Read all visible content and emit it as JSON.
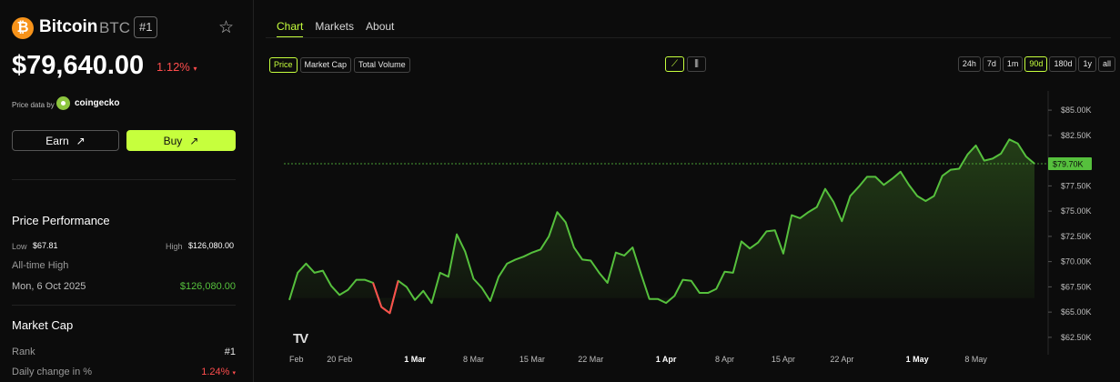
{
  "coin": {
    "logo_symbol": "₿",
    "name": "Bitcoin",
    "symbol": "BTC",
    "rank_badge": "#1",
    "price": "$79,640.00",
    "change_pct": "1.12%",
    "change_arrow": "▾",
    "price_source_label": "Price data by",
    "price_source_name": "coingecko"
  },
  "actions": {
    "earn_label": "Earn",
    "earn_icon": "↗",
    "buy_label": "Buy",
    "buy_icon": "↗"
  },
  "performance": {
    "title": "Price Performance",
    "low_label": "Low",
    "low_value": "$67.81",
    "high_label": "High",
    "high_value": "$126,080.00",
    "ath_label": "All-time High",
    "ath_date": "Mon, 6 Oct 2025",
    "ath_value": "$126,080.00"
  },
  "market_cap": {
    "title": "Market Cap",
    "rank_label": "Rank",
    "rank_value": "#1",
    "daily_change_label": "Daily change in %",
    "daily_change_value": "1.24%",
    "daily_change_arrow": "▾"
  },
  "tabs": [
    {
      "label": "Chart",
      "active": true
    },
    {
      "label": "Markets",
      "active": false
    },
    {
      "label": "About",
      "active": false
    }
  ],
  "metric_buttons": [
    {
      "label": "Price",
      "active": true
    },
    {
      "label": "Market Cap",
      "active": false
    },
    {
      "label": "Total Volume",
      "active": false
    }
  ],
  "view_buttons": [
    {
      "icon": "line-chart-icon",
      "glyph": "⟋",
      "active": true
    },
    {
      "icon": "candlestick-icon",
      "glyph": "⫼",
      "active": false
    }
  ],
  "range_buttons": [
    {
      "label": "24h",
      "active": false
    },
    {
      "label": "7d",
      "active": false
    },
    {
      "label": "1m",
      "active": false
    },
    {
      "label": "90d",
      "active": true
    },
    {
      "label": "180d",
      "active": false
    },
    {
      "label": "1y",
      "active": false
    },
    {
      "label": "all",
      "active": false
    }
  ],
  "watermark": "TV",
  "colors": {
    "accent": "#c6ff3d",
    "up": "#56c03d",
    "down": "#ff4d4d"
  },
  "chart_data": {
    "type": "line",
    "current_label": "$79.70K",
    "current_value": 79700,
    "ylim": [
      61500,
      86000
    ],
    "yticks": [
      62500,
      65000,
      67500,
      70000,
      72500,
      75000,
      77500,
      80000,
      82500,
      85000
    ],
    "ytick_labels": [
      "$62.50K",
      "$65.00K",
      "$67.50K",
      "$70.00K",
      "$72.50K",
      "$75.00K",
      "$77.50K",
      "$80.00K",
      "$82.50K",
      "$85.00K"
    ],
    "xticks": [
      {
        "label": "Feb",
        "index": 0,
        "bold": false
      },
      {
        "label": "20 Feb",
        "index": 6,
        "bold": false
      },
      {
        "label": "1 Mar",
        "index": 15,
        "bold": true
      },
      {
        "label": "8 Mar",
        "index": 22,
        "bold": false
      },
      {
        "label": "15 Mar",
        "index": 29,
        "bold": false
      },
      {
        "label": "22 Mar",
        "index": 36,
        "bold": false
      },
      {
        "label": "1 Apr",
        "index": 45,
        "bold": true
      },
      {
        "label": "8 Apr",
        "index": 52,
        "bold": false
      },
      {
        "label": "15 Apr",
        "index": 59,
        "bold": false
      },
      {
        "label": "22 Apr",
        "index": 66,
        "bold": false
      },
      {
        "label": "1 May",
        "index": 75,
        "bold": true
      },
      {
        "label": "8 May",
        "index": 82,
        "bold": false
      }
    ],
    "series": [
      {
        "values": [
          66200,
          68900,
          69800,
          68900,
          69100,
          67600,
          66700,
          67200,
          68200,
          68200,
          67900,
          65500,
          64900,
          68100,
          67500,
          66200,
          67100,
          65900,
          68900,
          68500,
          72700,
          71000,
          68300,
          67400,
          66100,
          68500,
          69800,
          70200,
          70500,
          70900,
          71200,
          72500,
          74900,
          73900,
          71400,
          70200,
          70100,
          68900,
          67900,
          70900,
          70600,
          71400,
          68800,
          66300,
          66300,
          65900,
          66600,
          68200,
          68100,
          66900,
          66900,
          67300,
          69000,
          68900,
          72000,
          71300,
          71900,
          73000,
          73100,
          70800,
          74600,
          74300,
          74900,
          75400,
          77200,
          75900,
          74000,
          76500,
          77400,
          78400,
          78400,
          77600,
          78200,
          78900,
          77600,
          76500,
          76000,
          76500,
          78500,
          79100,
          79200,
          80600,
          81500,
          80000,
          80200,
          80700,
          82100,
          81700,
          80400,
          79700
        ]
      }
    ],
    "down_segment": [
      11,
      12
    ]
  }
}
